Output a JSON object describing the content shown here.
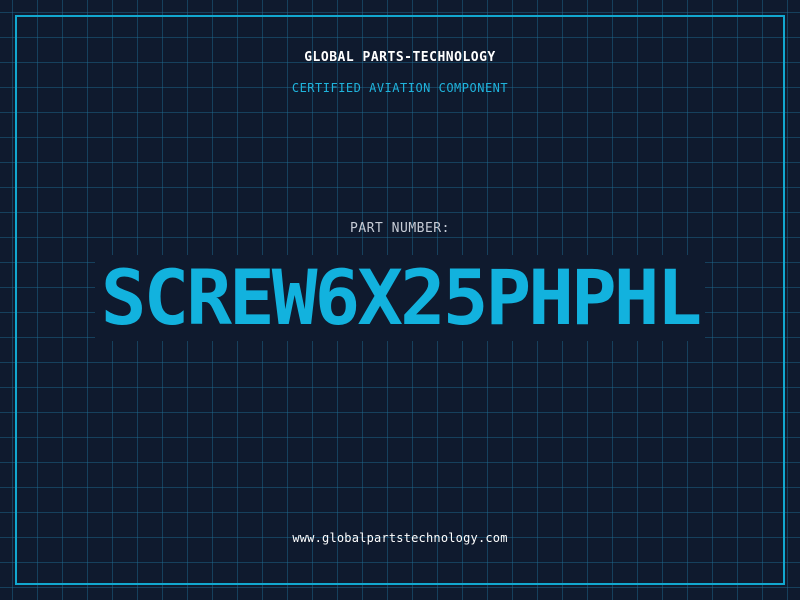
{
  "header": {
    "brand": "GLOBAL PARTS-TECHNOLOGY",
    "subtitle": "CERTIFIED AVIATION COMPONENT"
  },
  "main": {
    "label": "PART NUMBER:",
    "part_number": "SCREW6X25PHPHL"
  },
  "footer": {
    "url": "www.globalpartstechnology.com"
  },
  "colors": {
    "background": "#0f1a2e",
    "accent": "#12b2de",
    "grid": "#1e6e96",
    "frame": "#12a7cf"
  }
}
